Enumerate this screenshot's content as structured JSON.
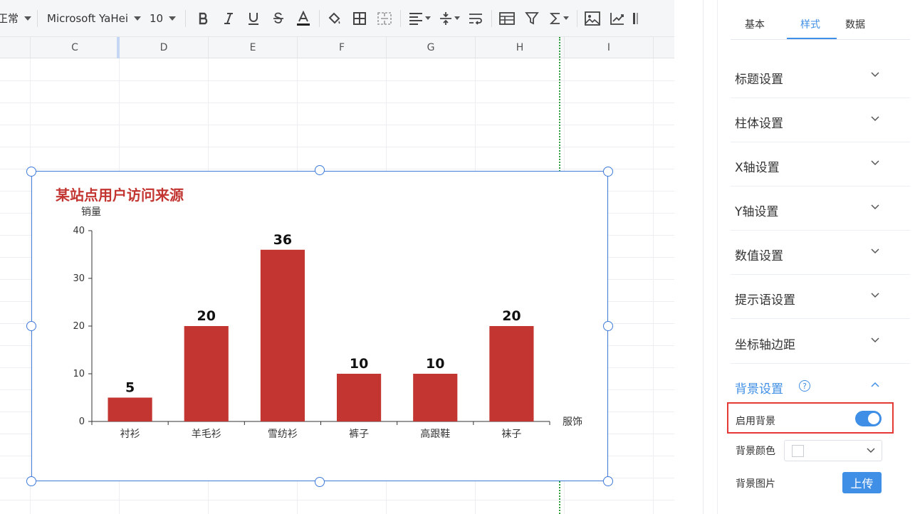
{
  "toolbar": {
    "style_select": "正常",
    "font_select": "Microsoft YaHei",
    "size_select": "10",
    "icons": [
      "bold-icon",
      "italic-icon",
      "underline-icon",
      "strikethrough-icon",
      "font-color-icon",
      "fill-color-icon",
      "border-icon",
      "merge-cells-icon",
      "align-icon",
      "valign-icon",
      "wrap-text-icon",
      "table-icon",
      "filter-icon",
      "sum-icon",
      "image-icon",
      "chart-icon"
    ]
  },
  "columns": [
    "C",
    "D",
    "E",
    "F",
    "G",
    "H",
    "I"
  ],
  "chart_data": {
    "type": "bar",
    "title": "某站点用户访问来源",
    "xlabel": "服饰",
    "ylabel": "销量",
    "categories": [
      "衬衫",
      "羊毛衫",
      "雪纺衫",
      "裤子",
      "高跟鞋",
      "袜子"
    ],
    "values": [
      5,
      20,
      36,
      10,
      10,
      20
    ],
    "ylim": [
      0,
      40
    ],
    "yticks": [
      0,
      10,
      20,
      30,
      40
    ],
    "bar_color": "#c23531",
    "title_color": "#c23531",
    "data_labels": true,
    "grid": false
  },
  "panel": {
    "tabs": [
      "基本",
      "样式",
      "数据"
    ],
    "active_tab": "样式",
    "sections": [
      {
        "label": "标题设置"
      },
      {
        "label": "柱体设置"
      },
      {
        "label": "X轴设置"
      },
      {
        "label": "Y轴设置"
      },
      {
        "label": "数值设置"
      },
      {
        "label": "提示语设置"
      },
      {
        "label": "坐标轴边距"
      },
      {
        "label": "背景设置"
      }
    ],
    "background": {
      "enable_label": "启用背景",
      "enabled": true,
      "color_label": "背景颜色",
      "color_value": "#ffffff",
      "image_label": "背景图片",
      "upload_label": "上传",
      "help_glyph": "?"
    },
    "accent_color": "#3f8fe6",
    "highlight_color": "#e53935"
  }
}
